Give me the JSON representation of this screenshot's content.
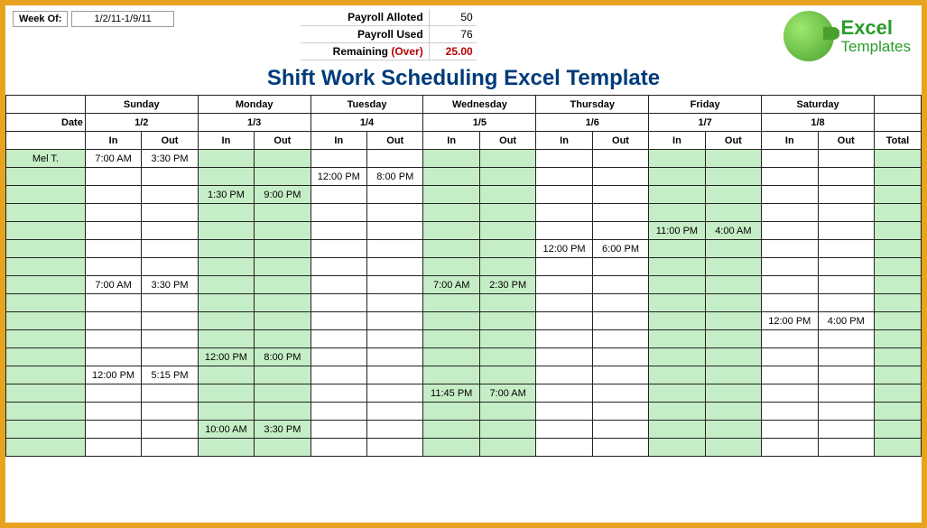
{
  "header": {
    "week_of_label": "Week Of:",
    "week_of_value": "1/2/11-1/9/11",
    "payroll_alloted_label": "Payroll Alloted",
    "payroll_alloted_value": "50",
    "payroll_used_label": "Payroll Used",
    "payroll_used_value": "76",
    "remaining_label": "Remaining",
    "over_label": "(Over)",
    "remaining_value": "25.00"
  },
  "logo": {
    "excel": "Excel",
    "templates": "Templates"
  },
  "title": "Shift Work Scheduling Excel Template",
  "days": [
    {
      "name": "Sunday",
      "date": "1/2",
      "accent": false
    },
    {
      "name": "Monday",
      "date": "1/3",
      "accent": true
    },
    {
      "name": "Tuesday",
      "date": "1/4",
      "accent": false
    },
    {
      "name": "Wednesday",
      "date": "1/5",
      "accent": true
    },
    {
      "name": "Thursday",
      "date": "1/6",
      "accent": false
    },
    {
      "name": "Friday",
      "date": "1/7",
      "accent": true
    },
    {
      "name": "Saturday",
      "date": "1/8",
      "accent": false
    }
  ],
  "date_label": "Date",
  "in_label": "In",
  "out_label": "Out",
  "total_label": "Total",
  "rows": [
    {
      "name": "Mel T.",
      "cells": [
        "7:00 AM",
        "3:30 PM",
        "",
        "",
        "",
        "",
        "",
        "",
        "",
        "",
        "",
        "",
        "",
        ""
      ]
    },
    {
      "name": "",
      "cells": [
        "",
        "",
        "",
        "",
        "12:00 PM",
        "8:00 PM",
        "",
        "",
        "",
        "",
        "",
        "",
        "",
        ""
      ]
    },
    {
      "name": "",
      "cells": [
        "",
        "",
        "1:30 PM",
        "9:00 PM",
        "",
        "",
        "",
        "",
        "",
        "",
        "",
        "",
        "",
        ""
      ]
    },
    {
      "name": "",
      "cells": [
        "",
        "",
        "",
        "",
        "",
        "",
        "",
        "",
        "",
        "",
        "",
        "",
        "",
        ""
      ]
    },
    {
      "name": "",
      "cells": [
        "",
        "",
        "",
        "",
        "",
        "",
        "",
        "",
        "",
        "",
        "11:00 PM",
        "4:00 AM",
        "",
        ""
      ]
    },
    {
      "name": "",
      "cells": [
        "",
        "",
        "",
        "",
        "",
        "",
        "",
        "",
        "12:00 PM",
        "6:00 PM",
        "",
        "",
        "",
        ""
      ]
    },
    {
      "name": "",
      "cells": [
        "",
        "",
        "",
        "",
        "",
        "",
        "",
        "",
        "",
        "",
        "",
        "",
        "",
        ""
      ]
    },
    {
      "name": "",
      "cells": [
        "7:00 AM",
        "3:30 PM",
        "",
        "",
        "",
        "",
        "7:00 AM",
        "2:30 PM",
        "",
        "",
        "",
        "",
        "",
        ""
      ]
    },
    {
      "name": "",
      "cells": [
        "",
        "",
        "",
        "",
        "",
        "",
        "",
        "",
        "",
        "",
        "",
        "",
        "",
        ""
      ]
    },
    {
      "name": "",
      "cells": [
        "",
        "",
        "",
        "",
        "",
        "",
        "",
        "",
        "",
        "",
        "",
        "",
        "12:00 PM",
        "4:00 PM"
      ]
    },
    {
      "name": "",
      "cells": [
        "",
        "",
        "",
        "",
        "",
        "",
        "",
        "",
        "",
        "",
        "",
        "",
        "",
        ""
      ]
    },
    {
      "name": "",
      "cells": [
        "",
        "",
        "12:00 PM",
        "8:00 PM",
        "",
        "",
        "",
        "",
        "",
        "",
        "",
        "",
        "",
        ""
      ]
    },
    {
      "name": "",
      "cells": [
        "12:00 PM",
        "5:15 PM",
        "",
        "",
        "",
        "",
        "",
        "",
        "",
        "",
        "",
        "",
        "",
        ""
      ]
    },
    {
      "name": "",
      "cells": [
        "",
        "",
        "",
        "",
        "",
        "",
        "11:45 PM",
        "7:00 AM",
        "",
        "",
        "",
        "",
        "",
        ""
      ]
    },
    {
      "name": "",
      "cells": [
        "",
        "",
        "",
        "",
        "",
        "",
        "",
        "",
        "",
        "",
        "",
        "",
        "",
        ""
      ]
    },
    {
      "name": "",
      "cells": [
        "",
        "",
        "10:00 AM",
        "3:30 PM",
        "",
        "",
        "",
        "",
        "",
        "",
        "",
        "",
        "",
        ""
      ]
    },
    {
      "name": "",
      "cells": [
        "",
        "",
        "",
        "",
        "",
        "",
        "",
        "",
        "",
        "",
        "",
        "",
        "",
        ""
      ]
    }
  ]
}
